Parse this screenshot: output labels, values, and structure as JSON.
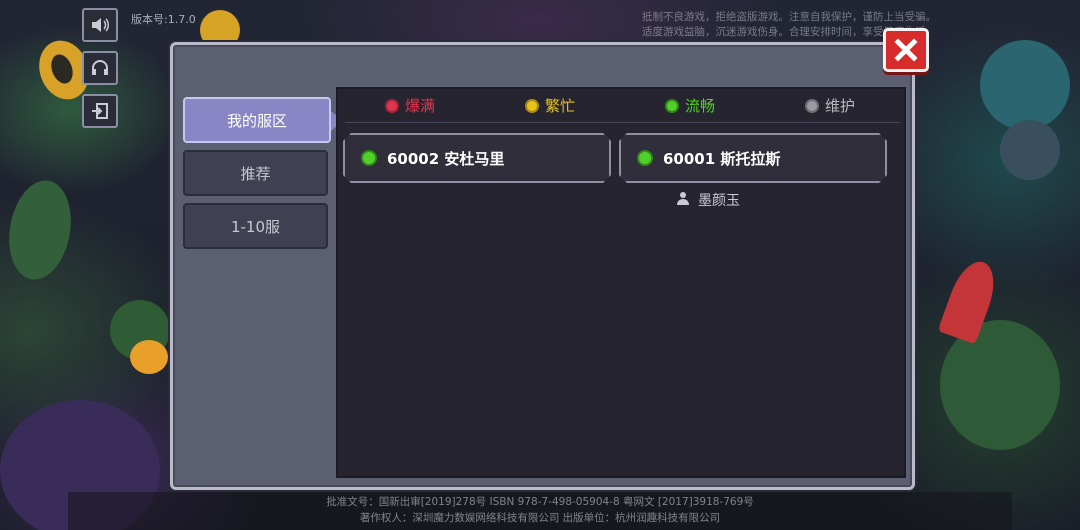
{
  "version_label": "版本号:1.7.0",
  "top_notice": {
    "line1": "抵制不良游戏，拒绝盗版游戏。注意自我保护，谨防上当受骗。",
    "line2": "适度游戏益脑，沉迷游戏伤身。合理安排时间，享受健康生活。"
  },
  "side_icons": [
    "speaker-icon",
    "headset-icon",
    "logout-icon"
  ],
  "tabs": [
    {
      "label": "我的服区",
      "active": true
    },
    {
      "label": "推荐",
      "active": false
    },
    {
      "label": "1-10服",
      "active": false
    }
  ],
  "legend": [
    {
      "label": "爆满",
      "color": "#e0354f"
    },
    {
      "label": "繁忙",
      "color": "#e8c21c"
    },
    {
      "label": "流畅",
      "color": "#53cf2b"
    },
    {
      "label": "维护",
      "color": "#9a9aa3"
    }
  ],
  "servers": [
    {
      "label": "60002 安杜马里",
      "status": "流畅"
    },
    {
      "label": "60001 斯托拉斯",
      "status": "流畅",
      "owner": "墨颜玉"
    }
  ],
  "footer": {
    "line1": "批准文号：国新出审[2019]278号 ISBN 978-7-498-05904-8 粤网文 [2017]3918-769号",
    "line2": "著作权人：深圳魔力数娱网络科技有限公司 出版单位：杭州润趣科技有限公司"
  }
}
